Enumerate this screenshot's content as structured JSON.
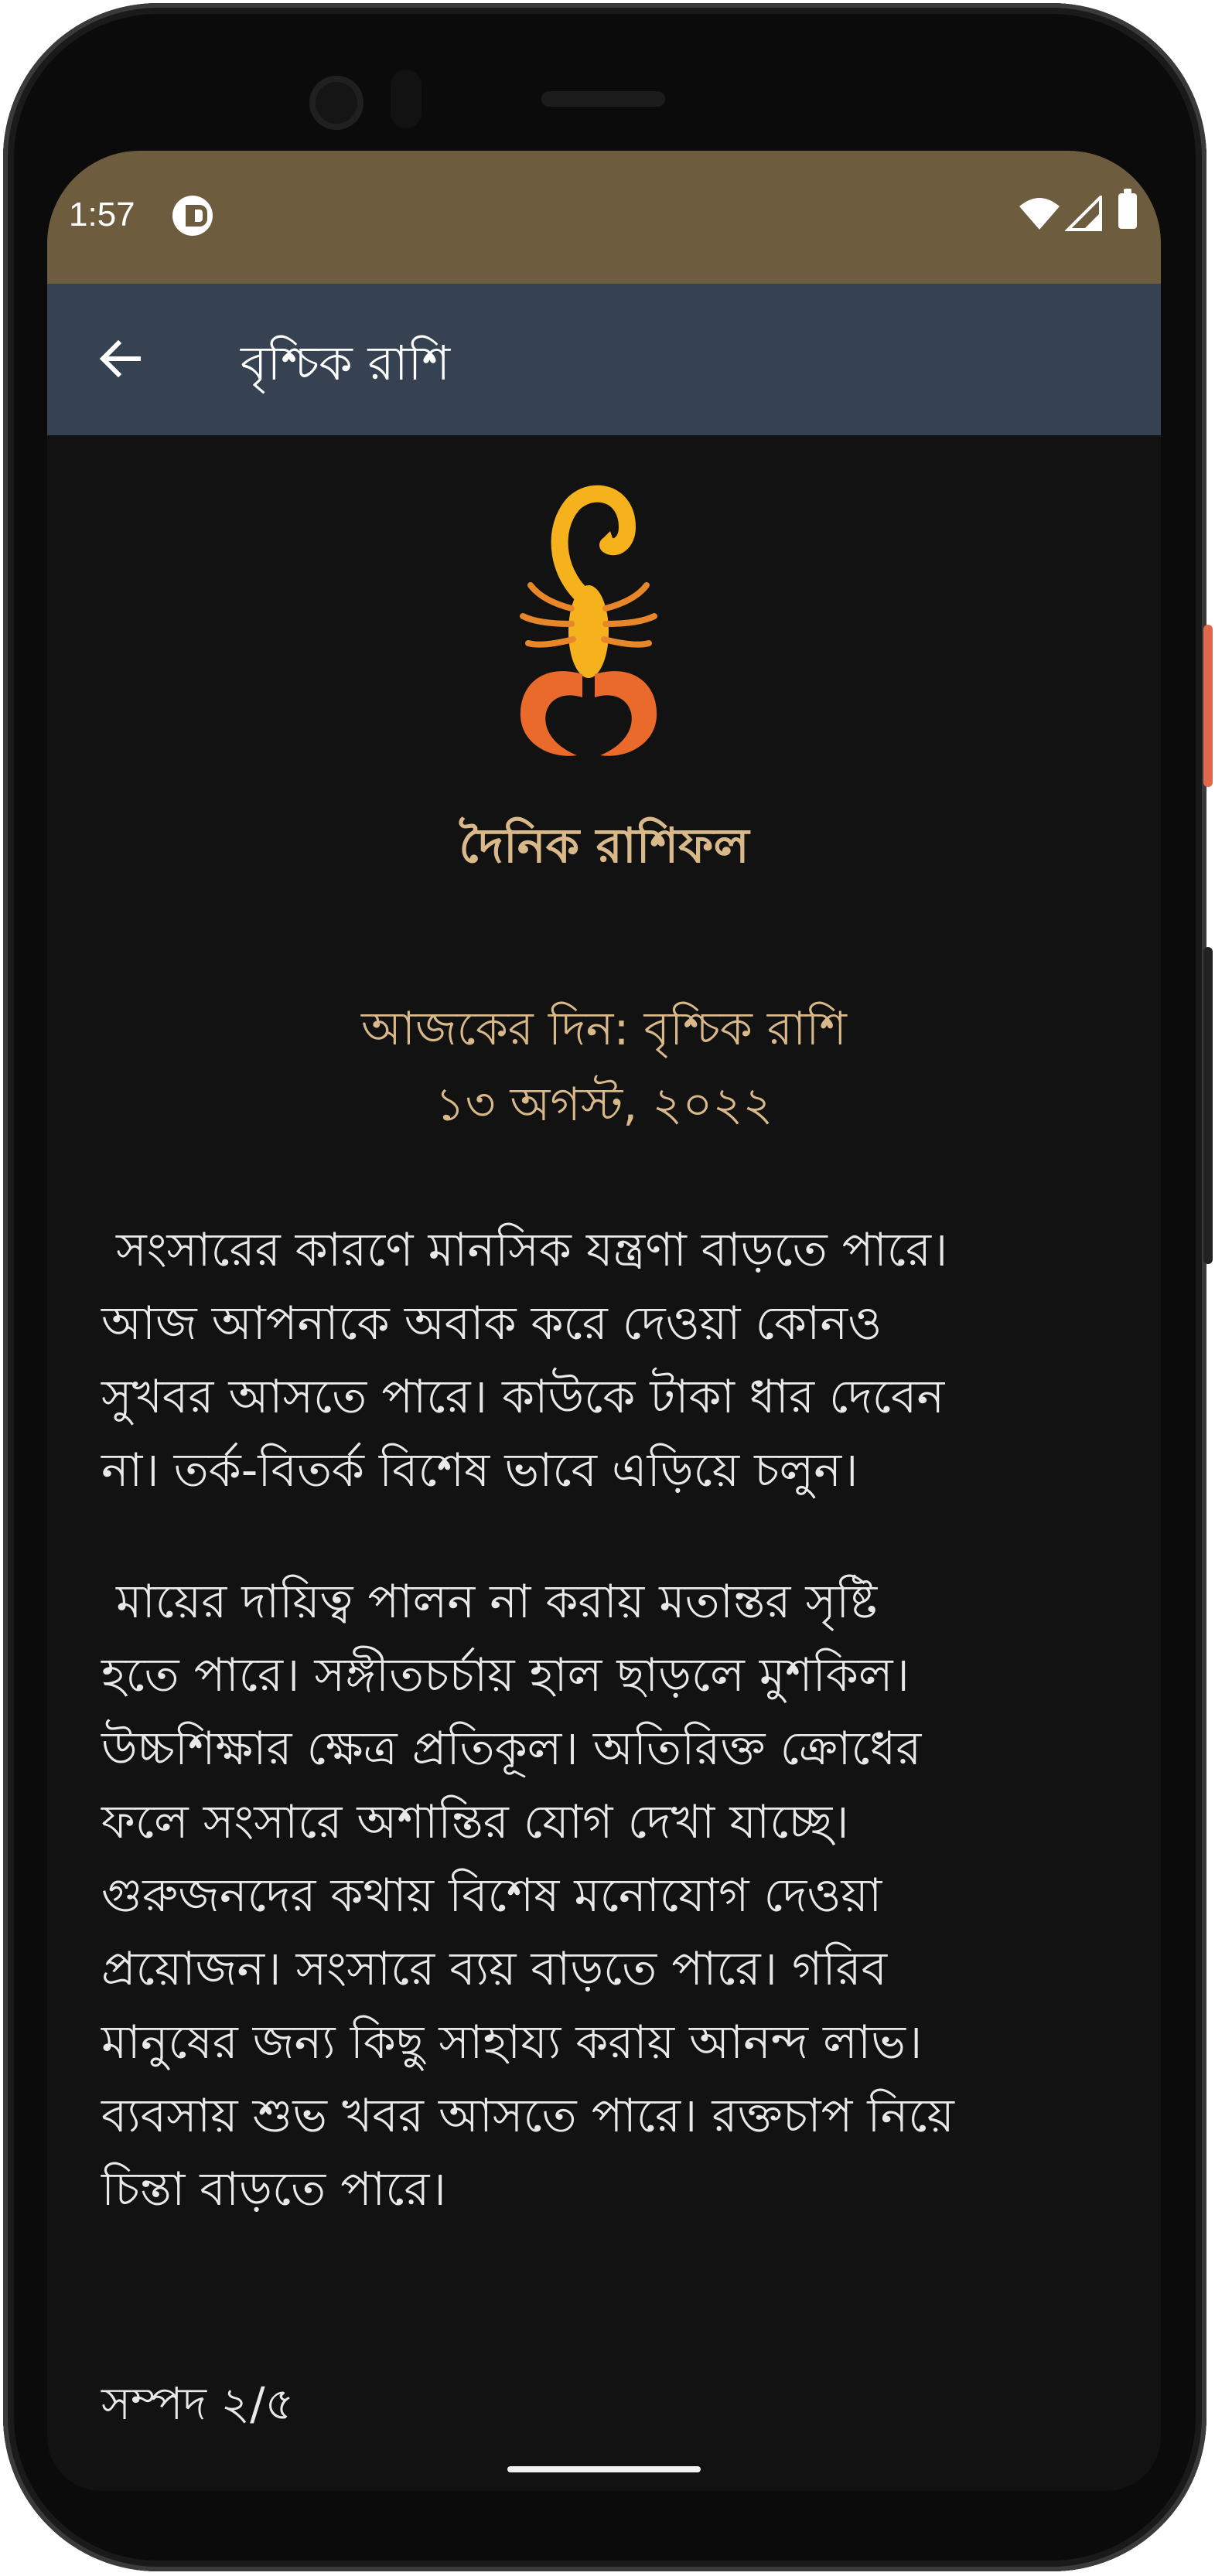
{
  "status_bar": {
    "time": "1:57"
  },
  "app_bar": {
    "title": "বৃশ্চিক রাশি"
  },
  "content": {
    "heading": "দৈনিক রাশিফল",
    "day_line": "আজকের দিন: বৃশ্চিক রাশি",
    "date_line": "১৩ অগস্ট, ২০২২",
    "paragraph_1": " সংসারের কারণে মানসিক যন্ত্রণা বাড়তে পারে।\nআজ আপনাকে অবাক করে দেওয়া কোনও\nসুখবর আসতে পারে। কাউকে টাকা ধার দেবেন\nনা। তর্ক-বিতর্ক বিশেষ ভাবে এড়িয়ে চলুন।",
    "paragraph_2": " মায়ের দায়িত্ব পালন না করায় মতান্তর সৃষ্টি\nহতে পারে। সঙ্গীতচর্চায় হাল ছাড়লে মুশকিল।\nউচ্চশিক্ষার ক্ষেত্র প্রতিকূল। অতিরিক্ত ক্রোধের\nফলে সংসারে অশান্তির যোগ দেখা যাচ্ছে।\nগুরুজনদের কথায় বিশেষ মনোযোগ দেওয়া\nপ্রয়োজন। সংসারে ব্যয় বাড়তে পারে। গরিব\nমানুষের জন্য কিছু সাহায্য করায় আনন্দ লাভ।\nব্যবসায় শুভ খবর আসতে পারে। রক্তচাপ নিয়ে\nচিন্তা বাড়তে পারে।",
    "footer_label": "সম্পদ ২/৫"
  },
  "icons": {
    "back": "arrow-left-icon",
    "logo": "scorpion-icon",
    "wifi": "wifi-icon",
    "signal": "signal-icon",
    "battery": "battery-icon"
  },
  "colors": {
    "status_bar": "#6d5c3e",
    "app_bar": "#364152",
    "background": "#121212",
    "accent_text": "#d9b98a",
    "body_text": "#e9e9e9"
  }
}
